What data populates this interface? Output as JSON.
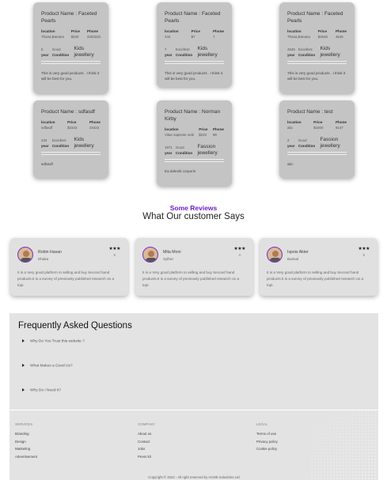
{
  "products": [
    {
      "name": "Product Name : Faceted Pearls",
      "location_label": "location",
      "location": "Thana,Banana",
      "price_label": "Price",
      "price": "$333",
      "phone_label": "Phone",
      "phone": "3333333",
      "year_label": "year",
      "year": "5",
      "condition_label": "Condition",
      "condition": "Good",
      "category": "Kids jewellery",
      "description": "This is very good products . I think it will be best for you."
    },
    {
      "name": "Product Name : Faceted Pearls",
      "location_label": "location",
      "location": "444",
      "price_label": "Price",
      "price": "$7",
      "phone_label": "Phone",
      "phone": "7",
      "year_label": "year",
      "year": "7",
      "condition_label": "Condition",
      "condition": "Excellent",
      "category": "Kids jewellery",
      "description": "This is very good products . I think it will be best for you."
    },
    {
      "name": "Product Name : Faceted Pearls",
      "location_label": "location",
      "location": "Thana,Banana",
      "price_label": "Price",
      "price": "$4545",
      "phone_label": "Phone",
      "phone": "4545",
      "year_label": "year",
      "year": "4545",
      "condition_label": "Condition",
      "condition": "Excellent",
      "category": "Kids jewellery",
      "description": "This is very good products . I think it will be best for you."
    },
    {
      "name": "Product Name : sdfasdf",
      "location_label": "location",
      "location": "sdfasdf",
      "price_label": "Price",
      "price": "$2342",
      "phone_label": "Phone",
      "phone": "23423",
      "year_label": "year",
      "year": "234",
      "condition_label": "Condition",
      "condition": "Excellent",
      "category": "Kids jewellery",
      "description": "sdfasdf"
    },
    {
      "name": "Product Name : Norman Kirby",
      "location_label": "location",
      "location": "Vitae sapiente velit",
      "price_label": "Price",
      "price": "$223",
      "phone_label": "Phone",
      "phone": "98",
      "year_label": "year",
      "year": "1971",
      "condition_label": "Condition",
      "condition": "Good",
      "category": "Fassion jewellery",
      "description": "Ea deleniti corporis"
    },
    {
      "name": "Product Name : test",
      "location_label": "location",
      "location": "abc",
      "price_label": "Price",
      "price": "$1000",
      "phone_label": "Phone",
      "phone": "9147",
      "year_label": "year",
      "year": "2",
      "condition_label": "Condition",
      "condition": "Good",
      "category": "Fassion jewellery",
      "description": "abc"
    }
  ],
  "reviews_section": {
    "kicker": "Some Reviews",
    "title": "What Our customer Says"
  },
  "reviews": [
    {
      "name": "Robin Hasan",
      "location": "Dhaka",
      "stars": "★★★",
      "rating": "5",
      "text": "It is a Very good platform to selling and buy Second hand products.It is a survey of previously published research on a topi."
    },
    {
      "name": "Mita Moni",
      "location": "Sylhet",
      "stars": "★★★",
      "rating": "4",
      "text": "It is a Very good platform to selling and buy Second hand products.It is a survey of previously published research on a topi."
    },
    {
      "name": "Ispois Akter",
      "location": "Barisal",
      "stars": "★★★",
      "rating": "5",
      "text": "It is a Very good platform to selling and buy Second hand products.It is a survey of previously published research on a topi."
    }
  ],
  "faq": {
    "title": "Frequently Asked Questions",
    "items": [
      "Why Do You Trust this website ?",
      "What Makes a Good Us?",
      "Why Do I Need It?"
    ]
  },
  "footer": {
    "services": {
      "heading": "SERVICES",
      "links": [
        "Branding",
        "Design",
        "Marketing",
        "Advertisement"
      ]
    },
    "company": {
      "heading": "COMPANY",
      "links": [
        "About us",
        "Contact",
        "Jobs",
        "Press kit"
      ]
    },
    "legal": {
      "heading": "LEGAL",
      "links": [
        "Terms of use",
        "Privacy policy",
        "Cookie policy"
      ]
    },
    "copyright": "Copyright © 2022 - All right reserved by ACME Industries Ltd"
  },
  "colors": {
    "accent": "#6a1fc9",
    "card": "#c4c4c4",
    "panel": "#e3e3e3"
  }
}
